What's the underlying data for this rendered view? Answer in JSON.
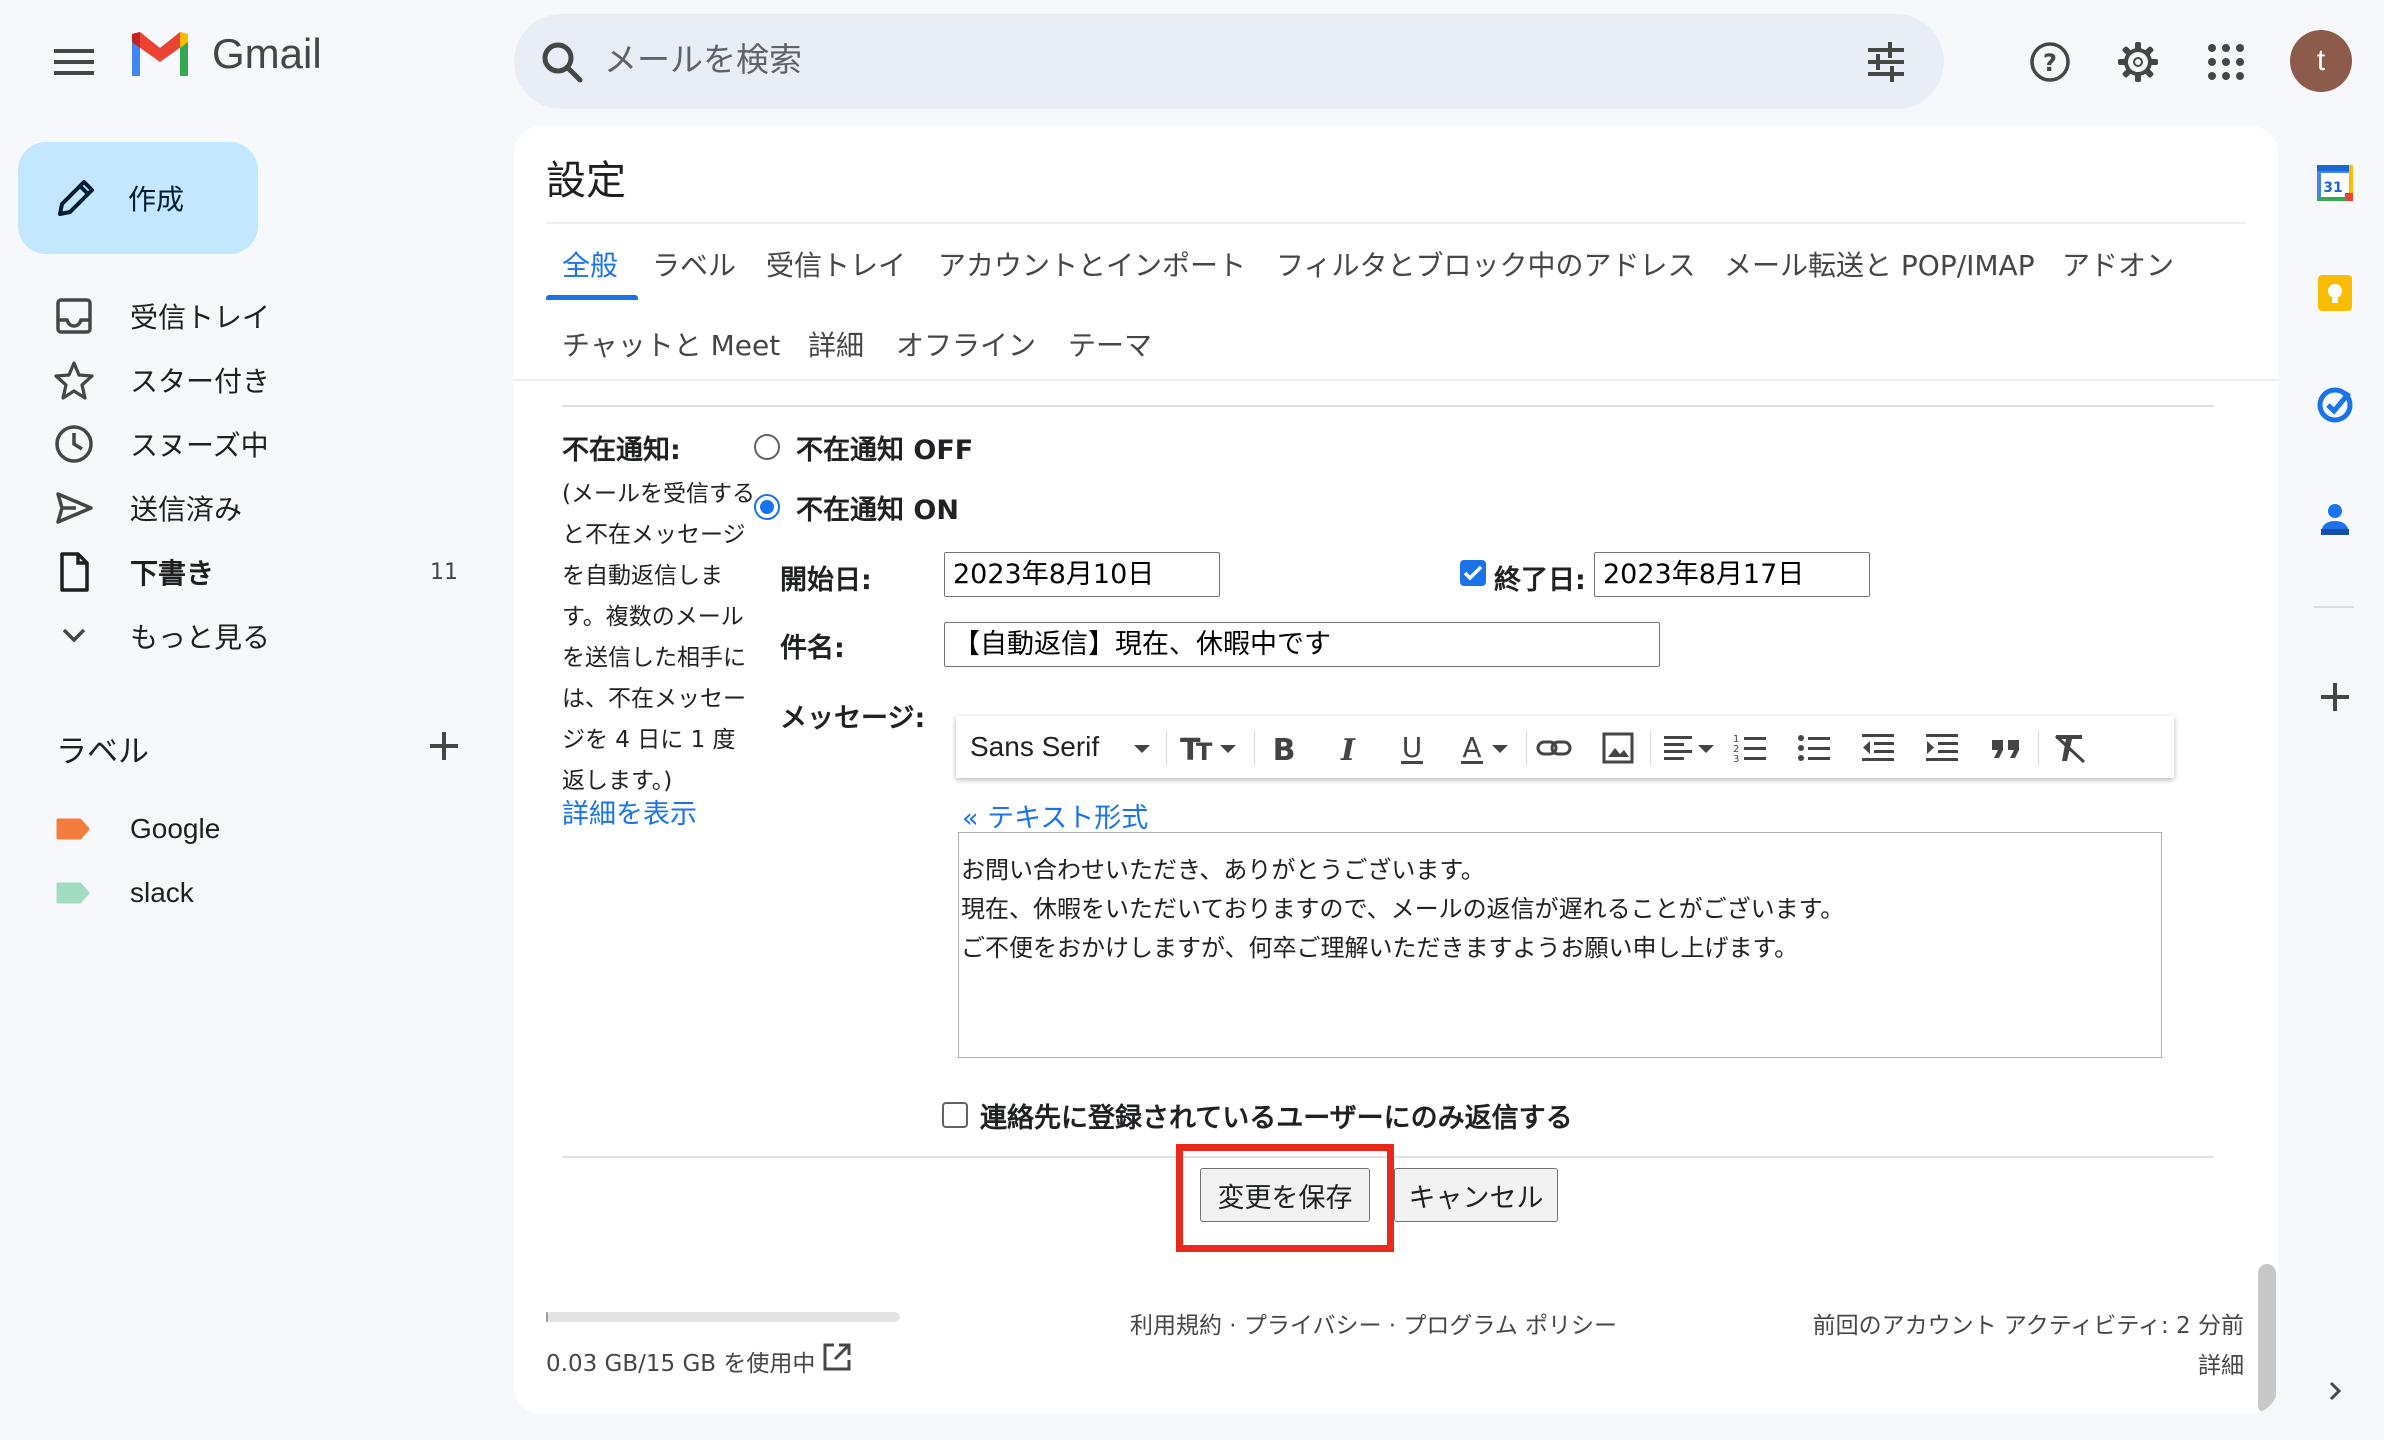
{
  "app": {
    "name": "Gmail"
  },
  "search": {
    "placeholder": "メールを検索"
  },
  "user": {
    "avatar_letter": "t"
  },
  "sidebar": {
    "compose_label": "作成",
    "items": [
      {
        "label": "受信トレイ",
        "count": "",
        "icon": "inbox-icon"
      },
      {
        "label": "スター付き",
        "count": "",
        "icon": "star-icon"
      },
      {
        "label": "スヌーズ中",
        "count": "",
        "icon": "clock-icon"
      },
      {
        "label": "送信済み",
        "count": "",
        "icon": "send-icon"
      },
      {
        "label": "下書き",
        "count": "11",
        "icon": "draft-icon"
      },
      {
        "label": "もっと見る",
        "count": "",
        "icon": "chevron-down-icon"
      }
    ],
    "labels_heading": "ラベル",
    "labels": [
      {
        "name": "Google",
        "color": "#f47c3c"
      },
      {
        "name": "slack",
        "color": "#a2dcc1"
      }
    ]
  },
  "settings": {
    "title": "設定",
    "tabs": [
      "全般",
      "ラベル",
      "受信トレイ",
      "アカウントとインポート",
      "フィルタとブロック中のアドレス",
      "メール転送と POP/IMAP",
      "アドオン",
      "チャットと Meet",
      "詳細",
      "オフライン",
      "テーマ"
    ],
    "active_tab": "全般",
    "ooo": {
      "label": "不在通知:",
      "description": "(メールを受信すると不在メッセージを自動返信します。複数のメールを送信した相手には、不在メッセージを 4 日に 1 度返します。)",
      "detail_link": "詳細を表示",
      "off_label": "不在通知 OFF",
      "on_label": "不在通知 ON",
      "selected": "ON",
      "start_label": "開始日:",
      "start_date": "2023年8月10日",
      "end_enabled": true,
      "end_label": "終了日:",
      "end_date": "2023年8月17日",
      "subject_label": "件名:",
      "subject": "【自動返信】現在、休暇中です",
      "message_label": "メッセージ:",
      "font": "Sans Serif",
      "plain_text_link": "« テキスト形式",
      "message_lines": [
        "お問い合わせいただき、ありがとうございます。",
        "現在、休暇をいただいておりますので、メールの返信が遅れることがございます。",
        "ご不便をおかけしますが、何卒ご理解いただきますようお願い申し上げます。"
      ],
      "contacts_only_label": "連絡先に登録されているユーザーにのみ返信する",
      "contacts_only": false
    },
    "save_label": "変更を保存",
    "cancel_label": "キャンセル"
  },
  "footer": {
    "storage": "0.03 GB/15 GB を使用中",
    "storage_fraction": 0.002,
    "links": "利用規約 · プライバシー · プログラム ポリシー",
    "last_activity": "前回のアカウント アクティビティ: 2 分前",
    "details": "詳細"
  },
  "colors": {
    "accent": "#1a73e8",
    "highlight": "#e8291c",
    "compose": "#c2e7ff"
  }
}
